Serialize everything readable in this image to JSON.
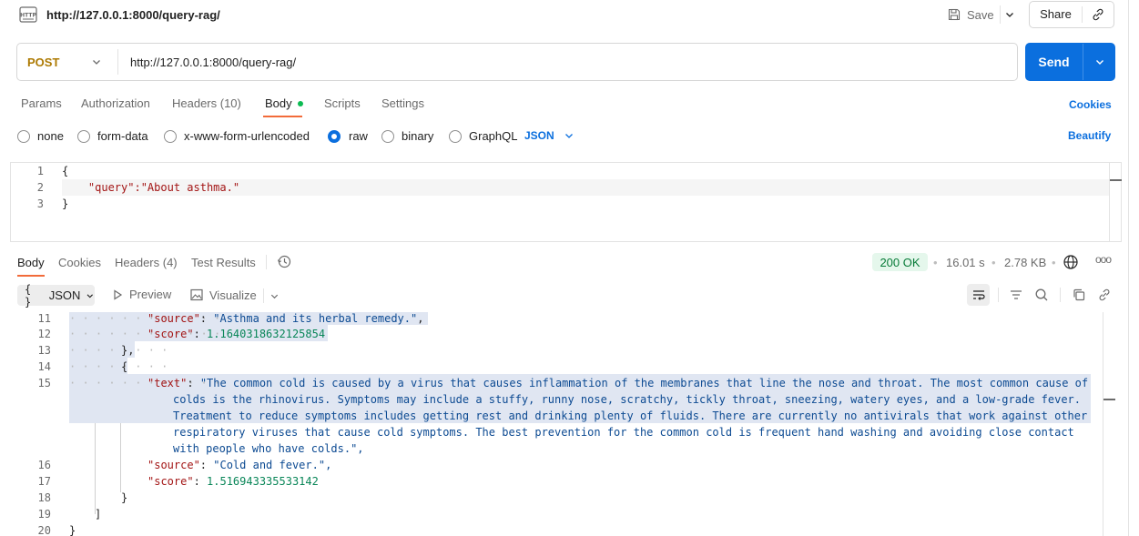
{
  "header": {
    "icon_label": "HTTP",
    "title": "http://127.0.0.1:8000/query-rag/",
    "save_label": "Save",
    "share_label": "Share"
  },
  "request": {
    "method": "POST",
    "url": "http://127.0.0.1:8000/query-rag/",
    "send_label": "Send"
  },
  "request_tabs": {
    "params": "Params",
    "authorization": "Authorization",
    "headers": "Headers (10)",
    "body": "Body",
    "scripts": "Scripts",
    "settings": "Settings",
    "active": "Body",
    "cookies_link": "Cookies"
  },
  "body_types": {
    "none": "none",
    "form_data": "form-data",
    "urlencoded": "x-www-form-urlencoded",
    "raw": "raw",
    "binary": "binary",
    "graphql": "GraphQL",
    "selected": "raw",
    "language": "JSON",
    "beautify_label": "Beautify"
  },
  "request_editor": {
    "line_numbers": [
      "1",
      "2",
      "3"
    ],
    "line1": "{",
    "line2": "    \"query\":\"About asthma.\"",
    "line3": "}"
  },
  "response_tabs": {
    "body": "Body",
    "cookies": "Cookies",
    "headers": "Headers (4)",
    "test_results": "Test Results",
    "active": "Body"
  },
  "response_meta": {
    "status": "200 OK",
    "time": "16.01 s",
    "size": "2.78 KB",
    "more": "ooo"
  },
  "response_toolbar": {
    "format": "JSON",
    "format_icon": "{ }",
    "preview": "Preview",
    "visualize": "Visualize"
  },
  "response_body": {
    "line_numbers": [
      "11",
      "12",
      "13",
      "14",
      "15",
      "16",
      "17",
      "18",
      "19",
      "20"
    ],
    "source1_key": "\"source\"",
    "source1_value": "\"Asthma and its herbal remedy.\"",
    "score1_key": "\"score\"",
    "score1_value": "1.1640318632125854",
    "close_obj": "},",
    "open_obj": "{",
    "text_key": "\"text\"",
    "text_value_lines": [
      "\"The common cold is caused by a virus that causes inflammation of the membranes that line the nose and throat. The most common cause of",
      "colds is the rhinovirus. Symptoms may include a stuffy, runny nose, scratchy, tickly throat, sneezing, watery eyes, and a low-grade fever.",
      "Treatment to reduce symptoms includes getting rest and drinking plenty of fluids. There are currently no antivirals that work against other",
      "respiratory viruses that cause cold symptoms. The best prevention for the common cold is frequent hand washing and avoiding close contact",
      "with people who have colds.\","
    ],
    "source2_key": "\"source\"",
    "source2_value": "\"Cold and fever.\",",
    "score2_key": "\"score\"",
    "score2_value": "1.516943335533142",
    "close_obj2": "}",
    "close_array": "]",
    "close_root": "}"
  },
  "colors": {
    "send_button": "#0b6fde",
    "method_post": "#ad7a03",
    "status_ok_bg": "#e5f7ec",
    "status_ok_text": "#067a37",
    "active_tab_underline": "#f26b3a",
    "json_key": "#a31515",
    "json_string": "#0c4a92",
    "json_number": "#098658"
  },
  "icons": [
    "http-icon",
    "save-icon",
    "chevron-down-icon",
    "link-icon",
    "history-icon",
    "globe-icon",
    "more-icon",
    "braces-icon",
    "play-icon",
    "image-icon",
    "wrap-lines-icon",
    "filter-icon",
    "search-icon",
    "copy-icon",
    "link-icon"
  ]
}
